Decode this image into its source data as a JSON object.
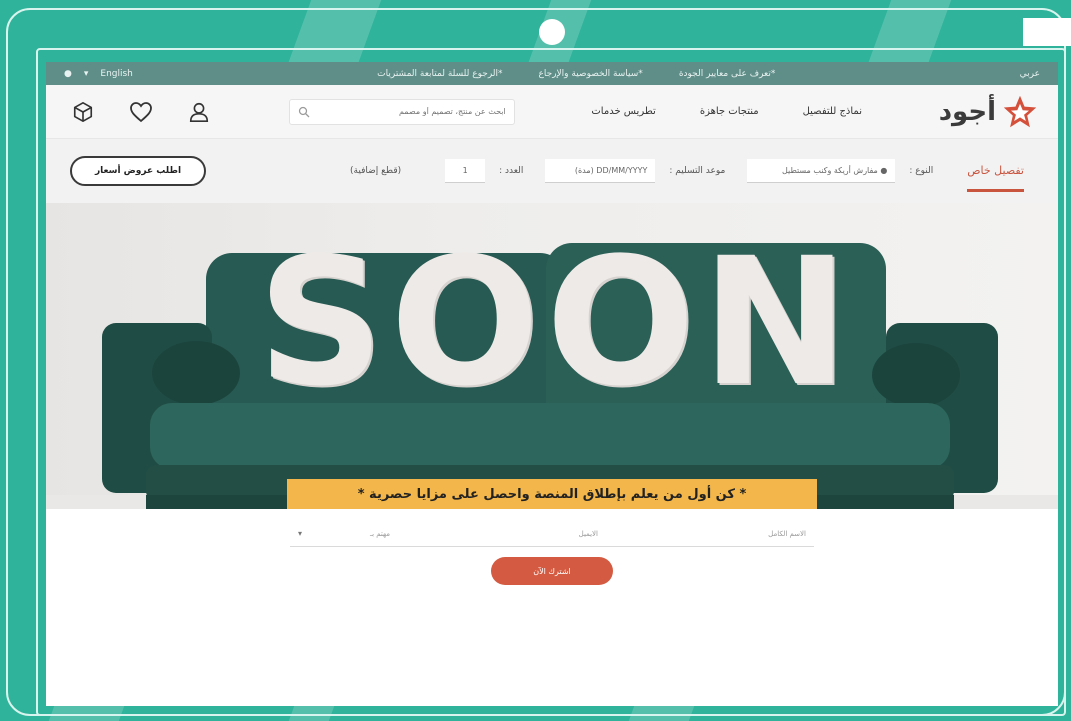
{
  "topbar": {
    "left_items": [
      "●",
      "▾",
      "English"
    ],
    "center_items": [
      "*تعرف على معايير الجودة",
      "*سياسة الخصوصية والإرجاع",
      "*الرجوع للسلة لمتابعة المشتريات"
    ],
    "right_item": "عربي"
  },
  "header": {
    "logo_text": "أجود",
    "nav": [
      "نماذج للتفصيل",
      "منتجات جاهزة",
      "تطريس خدمات"
    ],
    "search_placeholder": "ابحث عن منتج، تصميم أو مصمم",
    "icons": [
      "cube-icon",
      "heart-icon",
      "user-icon"
    ]
  },
  "subbar": {
    "tab": "تفصيل خاص",
    "type_label": "النوع :",
    "type_value": "● مفارش أريكة وكنب مستطيل",
    "delivery_label": "موعد التسليم :",
    "delivery_value": "DD/MM/YYYY (مدة)",
    "qty_label": "العدد :",
    "qty_value": "1",
    "extra_label": "(قطع إضافية)",
    "offers_button": "اطلب عروض أسعار"
  },
  "hero": {
    "soon_text": "SOON",
    "promo_text": "* كن أول من يعلم بإطلاق المنصة واحصل على مزايا حصرية *"
  },
  "form": {
    "name_placeholder": "الاسم الكامل",
    "email_placeholder": "الايميل",
    "role_placeholder": "مهتم بـ",
    "submit_label": "اشترك الآن"
  },
  "colors": {
    "frame": "#2fb39a",
    "topbar": "#5f8d88",
    "accent": "#c9553f",
    "promo": "#f2b64a",
    "sofa": "#234e46"
  }
}
